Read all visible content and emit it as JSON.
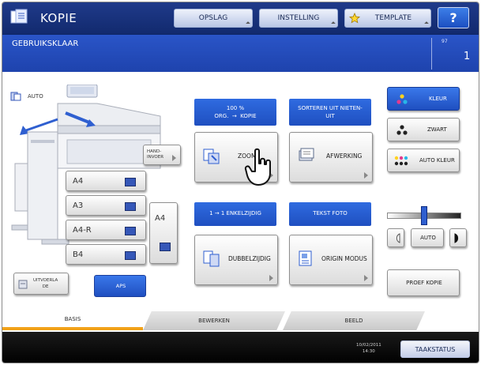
{
  "header": {
    "title": "KOPIE",
    "buttons": [
      "OPSLAG",
      "INSTELLING",
      "TEMPLATE"
    ],
    "help_label": "?"
  },
  "status": {
    "message": "GEBRUIKSKLAAR",
    "small_label": "97",
    "copies": "1"
  },
  "machine": {
    "auto_label": "AUTO",
    "manual_feed_label": "HAND-\nINVOER",
    "output_label": "UITVOERLA\nDE",
    "aps_label": "APS",
    "paper_sizes": [
      "A4",
      "A3",
      "A4-R",
      "B4"
    ],
    "bypass_size": "A4"
  },
  "functions": {
    "zoom_header": "100 %\nORG.  →  KOPIE",
    "zoom_label": "ZOOM",
    "finishing_header": "SORTEREN UIT NIETEN-\nUIT",
    "finishing_label": "AFWERKING",
    "duplex_header": "1 → 1 ENKELZIJDIG",
    "duplex_label": "DUBBELZIJDIG",
    "original_header": "TEKST FOTO",
    "original_label": "ORIGIN MODUS"
  },
  "color": {
    "color_label": "KLEUR",
    "black_label": "ZWART",
    "auto_color_label": "AUTO KLEUR",
    "density_level": 0.5,
    "density_auto_label": "AUTO",
    "proof_label": "PROEF KOPIE"
  },
  "tabs": [
    "BASIS",
    "BEWERKEN",
    "BEELD"
  ],
  "footer": {
    "date": "10/02/2011",
    "time": "14:30",
    "job_status_label": "TAAKSTATUS"
  },
  "colors": {
    "header_blue": "#1f3a8a",
    "status_blue": "#2a55c8",
    "accent_orange": "#f2a21a"
  }
}
